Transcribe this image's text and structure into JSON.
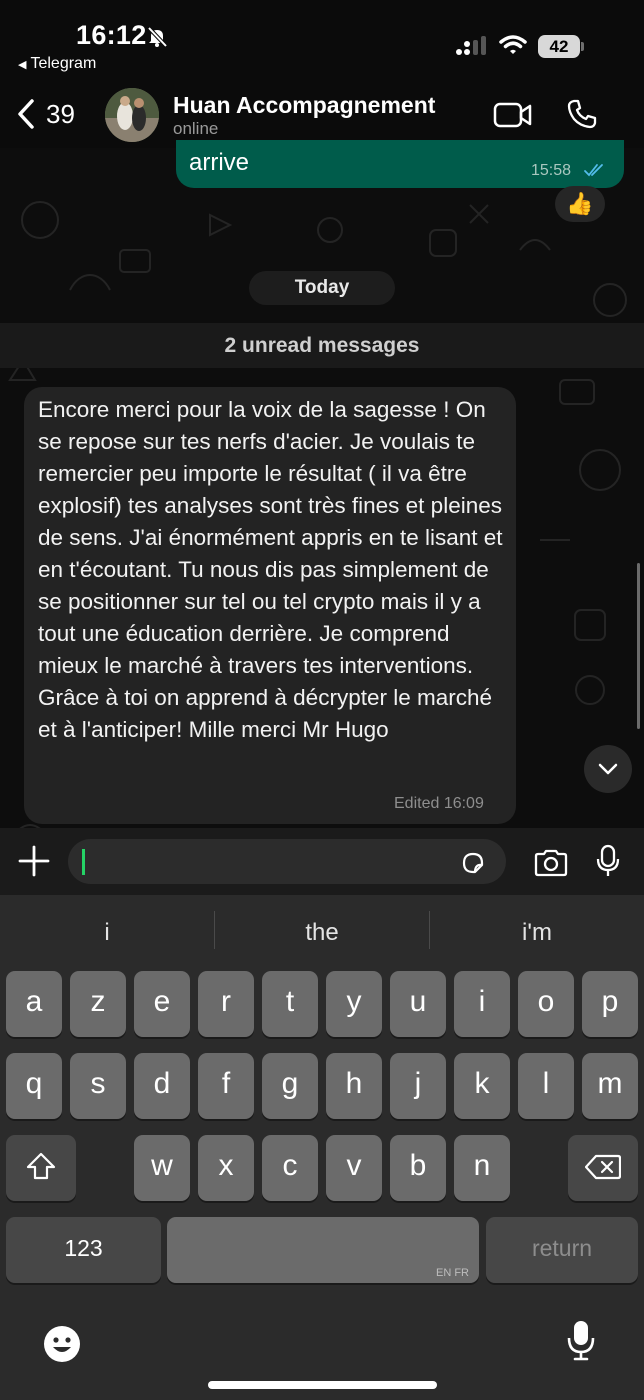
{
  "status_bar": {
    "time": "16:12",
    "back_app": "Telegram",
    "battery": "42"
  },
  "header": {
    "back_count": "39",
    "contact_name": "Huan Accompagnement",
    "contact_status": "online"
  },
  "messages": {
    "outgoing": {
      "text": "arrive",
      "time": "15:58",
      "reaction": "👍"
    },
    "date_separator": "Today",
    "unread_banner": "2 unread messages",
    "incoming": {
      "text": "Encore merci pour la voix de la sagesse ! On se repose sur tes nerfs d'acier. Je voulais te remercier peu importe le résultat ( il va être explosif) tes analyses sont très fines et pleines de sens. J'ai énormément appris en te lisant et en t'écoutant. Tu nous dis pas simplement de se positionner sur tel ou tel crypto mais il y a tout une éducation derrière. Je comprend mieux le marché à travers tes interventions. Grâce à toi on apprend à décrypter le marché et à l'anticiper! Mille merci Mr Hugo",
      "meta": "Edited 16:09"
    }
  },
  "composer": {
    "value": ""
  },
  "keyboard": {
    "suggestions": [
      "i",
      "the",
      "i'm"
    ],
    "row1": [
      "a",
      "z",
      "e",
      "r",
      "t",
      "y",
      "u",
      "i",
      "o",
      "p"
    ],
    "row2": [
      "q",
      "s",
      "d",
      "f",
      "g",
      "h",
      "j",
      "k",
      "l",
      "m"
    ],
    "row3": [
      "w",
      "x",
      "c",
      "v",
      "b",
      "n"
    ],
    "numbers_label": "123",
    "space_language": "EN FR",
    "return_label": "return"
  },
  "colors": {
    "outgoing_bubble": "#005c4b",
    "incoming_bubble": "#232323",
    "accent_green": "#25d366",
    "read_ticks": "#53bdeb"
  }
}
